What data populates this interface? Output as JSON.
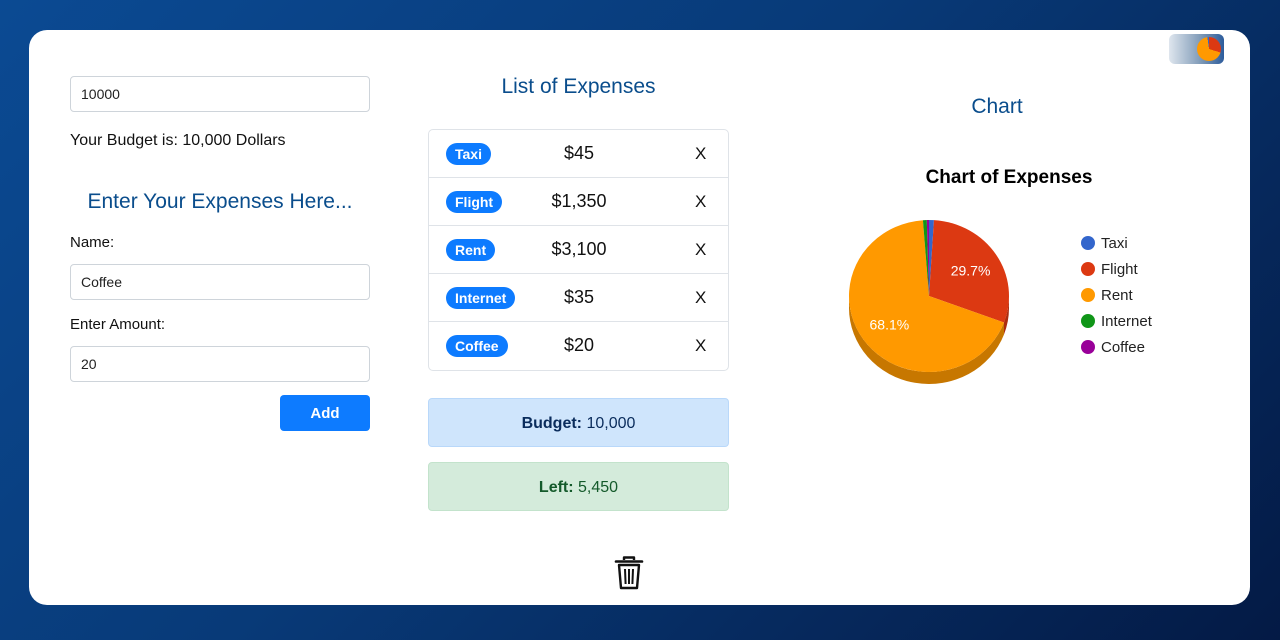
{
  "budget_form": {
    "budget_value": "10000",
    "budget_text": "Your Budget is: 10,000 Dollars"
  },
  "expense_form": {
    "title": "Enter Your Expenses Here...",
    "name_label": "Name:",
    "name_value": "Coffee",
    "amount_label": "Enter Amount:",
    "amount_value": "20",
    "add_button": "Add"
  },
  "expense_list": {
    "title": "List of Expenses",
    "delete_label": "X",
    "items": [
      {
        "name": "Taxi",
        "amount": "$45"
      },
      {
        "name": "Flight",
        "amount": "$1,350"
      },
      {
        "name": "Rent",
        "amount": "$3,100"
      },
      {
        "name": "Internet",
        "amount": "$35"
      },
      {
        "name": "Coffee",
        "amount": "$20"
      }
    ]
  },
  "summary": {
    "budget_label": "Budget:",
    "budget_value": "10,000",
    "left_label": "Left:",
    "left_value": "5,450"
  },
  "icons": {
    "trash": "trash-icon"
  },
  "chart_section": {
    "heading": "Chart"
  },
  "chart_data": {
    "type": "pie",
    "title": "Chart of Expenses",
    "legend_position": "right",
    "categories": [
      "Taxi",
      "Flight",
      "Rent",
      "Internet",
      "Coffee"
    ],
    "values": [
      45,
      1350,
      3100,
      35,
      20
    ],
    "colors": [
      "#3366cc",
      "#dc3912",
      "#ff9900",
      "#109618",
      "#990099"
    ],
    "data_labels": [
      "",
      "29.7%",
      "68.1%",
      "",
      ""
    ]
  }
}
